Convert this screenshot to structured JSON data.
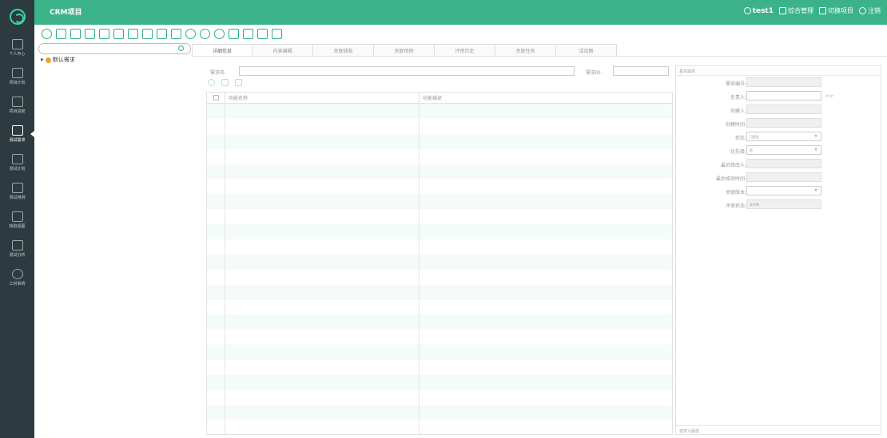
{
  "app": {
    "project_title": "CRM项目",
    "user": "test1",
    "top_actions": [
      {
        "label": "综合管理",
        "icon": "list-icon"
      },
      {
        "label": "切换项目",
        "icon": "switch-icon"
      },
      {
        "label": "注销",
        "icon": "power-icon"
      }
    ]
  },
  "sidebar": {
    "items": [
      {
        "label": "个人中心",
        "icon": "user-icon"
      },
      {
        "label": "项目计划",
        "icon": "plan-icon"
      },
      {
        "label": "项目进度",
        "icon": "progress-icon"
      },
      {
        "label": "测试需求",
        "icon": "requirement-icon",
        "active": true
      },
      {
        "label": "测试计划",
        "icon": "test-plan-icon"
      },
      {
        "label": "测试用例",
        "icon": "test-case-icon"
      },
      {
        "label": "缺陷视图",
        "icon": "defect-icon"
      },
      {
        "label": "测试分析",
        "icon": "analysis-icon"
      },
      {
        "label": "工时系统",
        "icon": "clock-icon"
      }
    ]
  },
  "toolbar": {
    "icons": [
      "refresh-icon",
      "copy-icon",
      "tree-add-icon",
      "move-icon",
      "delete-icon",
      "save-icon",
      "import-icon",
      "export-icon",
      "review-icon",
      "doc-icon",
      "sync-icon",
      "link-icon",
      "unlink-icon",
      "hierarchy-icon",
      "merge-icon",
      "report-icon",
      "list-view-icon"
    ]
  },
  "tree": {
    "root_label": "默认需求"
  },
  "tabs": [
    {
      "label": "详细信息",
      "active": true
    },
    {
      "label": "内容编辑"
    },
    {
      "label": "关联缺陷"
    },
    {
      "label": "关联用例"
    },
    {
      "label": "评审历史"
    },
    {
      "label": "关联任务"
    },
    {
      "label": "活动图"
    }
  ],
  "detail": {
    "name_label": "需求名:",
    "id_label": "需求ID:",
    "grid_actions": [
      "add-icon",
      "save-icon",
      "delete-icon"
    ],
    "columns": [
      "功能名称",
      "功能描述"
    ],
    "row_count": 22
  },
  "props": {
    "header": "基本属性",
    "footer": "自定义属性",
    "fields": [
      {
        "label": "需求编号:",
        "value": ""
      },
      {
        "label": "负责人:",
        "value": "",
        "editable": true,
        "more": ">>"
      },
      {
        "label": "创建人:",
        "value": ""
      },
      {
        "label": "创建时间:",
        "value": ""
      },
      {
        "label": "状态:",
        "value": "已提议",
        "editable": true,
        "dropdown": true
      },
      {
        "label": "优先级:",
        "value": "低",
        "editable": true,
        "dropdown": true
      },
      {
        "label": "最后修改人:",
        "value": ""
      },
      {
        "label": "最后修改时间:",
        "value": ""
      },
      {
        "label": "关联版本:",
        "value": "",
        "editable": true,
        "dropdown": true
      },
      {
        "label": "评审状态:",
        "value": "未评审"
      }
    ]
  },
  "colors": {
    "accent": "#3bb28a",
    "sidebar": "#2d3a3f"
  }
}
